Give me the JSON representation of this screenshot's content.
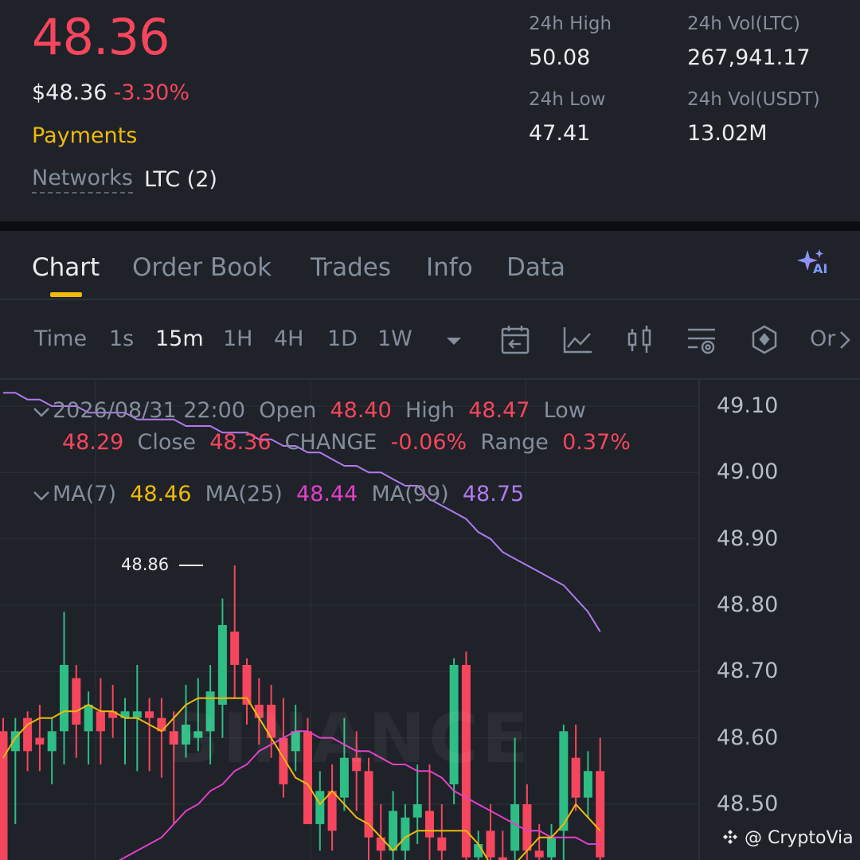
{
  "ticker": {
    "last_price": "48.36",
    "usd_price": "$48.36",
    "change_pct": "-3.30%",
    "category": "Payments",
    "networks_label": "Networks",
    "networks_value": "LTC (2)"
  },
  "stats": {
    "high_label": "24h High",
    "high_value": "50.08",
    "low_label": "24h Low",
    "low_value": "47.41",
    "vol_base_label": "24h Vol(LTC)",
    "vol_base_value": "267,941.17",
    "vol_quote_label": "24h Vol(USDT)",
    "vol_quote_value": "13.02M"
  },
  "tabs": [
    "Chart",
    "Order Book",
    "Trades",
    "Info",
    "Data"
  ],
  "ai_label": "AI",
  "timeframes": {
    "label": "Time",
    "items": [
      "1s",
      "15m",
      "1H",
      "4H",
      "1D",
      "1W"
    ],
    "more": "Or"
  },
  "candle_info": {
    "datetime": "2026/08/31 22:00",
    "open_label": "Open",
    "open": "48.40",
    "high_label": "High",
    "high": "48.47",
    "low_label": "Low",
    "low": "48.29",
    "close_label": "Close",
    "close": "48.36",
    "change_label": "CHANGE",
    "change": "-0.06%",
    "range_label": "Range",
    "range": "0.37%"
  },
  "ma_info": {
    "ma7_label": "MA(7)",
    "ma7": "48.46",
    "ma25_label": "MA(25)",
    "ma25": "48.44",
    "ma99_label": "MA(99)",
    "ma99": "48.75"
  },
  "price_axis": [
    "49.10",
    "49.00",
    "48.90",
    "48.80",
    "48.70",
    "48.60",
    "48.50"
  ],
  "max_marker": "48.86",
  "watermark": "BINANCE",
  "credit": "@ CryptoVia",
  "colors": {
    "up": "#2ebd85",
    "down": "#f6465d",
    "ma7": "#f0b90b",
    "ma25": "#e040c8",
    "ma99": "#b179f1",
    "accent": "#f0b90b"
  },
  "chart_data": {
    "type": "candlestick",
    "interval": "15m",
    "ylim": [
      48.4,
      49.13
    ],
    "candles": [
      {
        "o": 48.61,
        "h": 48.63,
        "l": 48.38,
        "c": 48.41
      },
      {
        "o": 48.58,
        "h": 48.63,
        "l": 48.47,
        "c": 48.61
      },
      {
        "o": 48.63,
        "h": 48.64,
        "l": 48.55,
        "c": 48.58
      },
      {
        "o": 48.6,
        "h": 48.65,
        "l": 48.55,
        "c": 48.59
      },
      {
        "o": 48.58,
        "h": 48.63,
        "l": 48.53,
        "c": 48.61
      },
      {
        "o": 48.61,
        "h": 48.79,
        "l": 48.56,
        "c": 48.71
      },
      {
        "o": 48.69,
        "h": 48.71,
        "l": 48.57,
        "c": 48.62
      },
      {
        "o": 48.61,
        "h": 48.67,
        "l": 48.56,
        "c": 48.65
      },
      {
        "o": 48.64,
        "h": 48.69,
        "l": 48.56,
        "c": 48.61
      },
      {
        "o": 48.64,
        "h": 48.68,
        "l": 48.6,
        "c": 48.63
      },
      {
        "o": 48.63,
        "h": 48.66,
        "l": 48.56,
        "c": 48.64
      },
      {
        "o": 48.63,
        "h": 48.71,
        "l": 48.55,
        "c": 48.64
      },
      {
        "o": 48.64,
        "h": 48.66,
        "l": 48.55,
        "c": 48.63
      },
      {
        "o": 48.63,
        "h": 48.66,
        "l": 48.54,
        "c": 48.61
      },
      {
        "o": 48.61,
        "h": 48.64,
        "l": 48.47,
        "c": 48.59
      },
      {
        "o": 48.59,
        "h": 48.68,
        "l": 48.57,
        "c": 48.62
      },
      {
        "o": 48.6,
        "h": 48.69,
        "l": 48.58,
        "c": 48.61
      },
      {
        "o": 48.61,
        "h": 48.71,
        "l": 48.56,
        "c": 48.67
      },
      {
        "o": 48.65,
        "h": 48.81,
        "l": 48.6,
        "c": 48.77
      },
      {
        "o": 48.76,
        "h": 48.86,
        "l": 48.66,
        "c": 48.71
      },
      {
        "o": 48.71,
        "h": 48.72,
        "l": 48.62,
        "c": 48.65
      },
      {
        "o": 48.65,
        "h": 48.69,
        "l": 48.59,
        "c": 48.63
      },
      {
        "o": 48.65,
        "h": 48.68,
        "l": 48.57,
        "c": 48.6
      },
      {
        "o": 48.6,
        "h": 48.66,
        "l": 48.51,
        "c": 48.53
      },
      {
        "o": 48.58,
        "h": 48.65,
        "l": 48.55,
        "c": 48.61
      },
      {
        "o": 48.61,
        "h": 48.63,
        "l": 48.5,
        "c": 48.47
      },
      {
        "o": 48.47,
        "h": 48.55,
        "l": 48.43,
        "c": 48.52
      },
      {
        "o": 48.52,
        "h": 48.56,
        "l": 48.43,
        "c": 48.46
      },
      {
        "o": 48.51,
        "h": 48.63,
        "l": 48.49,
        "c": 48.57
      },
      {
        "o": 48.57,
        "h": 48.61,
        "l": 48.49,
        "c": 48.55
      },
      {
        "o": 48.55,
        "h": 48.57,
        "l": 48.4,
        "c": 48.45
      },
      {
        "o": 48.45,
        "h": 48.5,
        "l": 48.4,
        "c": 48.43
      },
      {
        "o": 48.43,
        "h": 48.52,
        "l": 48.4,
        "c": 48.49
      },
      {
        "o": 48.43,
        "h": 48.5,
        "l": 48.4,
        "c": 48.48
      },
      {
        "o": 48.48,
        "h": 48.56,
        "l": 48.44,
        "c": 48.5
      },
      {
        "o": 48.49,
        "h": 48.56,
        "l": 48.41,
        "c": 48.45
      },
      {
        "o": 48.45,
        "h": 48.5,
        "l": 48.4,
        "c": 48.43
      },
      {
        "o": 48.53,
        "h": 48.72,
        "l": 48.5,
        "c": 48.71
      },
      {
        "o": 48.71,
        "h": 48.73,
        "l": 48.4,
        "c": 48.42
      },
      {
        "o": 48.42,
        "h": 48.46,
        "l": 48.4,
        "c": 48.44
      },
      {
        "o": 48.46,
        "h": 48.5,
        "l": 48.4,
        "c": 48.42
      },
      {
        "o": 48.42,
        "h": 48.46,
        "l": 48.4,
        "c": 48.41
      },
      {
        "o": 48.43,
        "h": 48.6,
        "l": 48.4,
        "c": 48.5
      },
      {
        "o": 48.5,
        "h": 48.53,
        "l": 48.4,
        "c": 48.43
      },
      {
        "o": 48.43,
        "h": 48.47,
        "l": 48.4,
        "c": 48.42
      },
      {
        "o": 48.42,
        "h": 48.47,
        "l": 48.4,
        "c": 48.45
      },
      {
        "o": 48.46,
        "h": 48.62,
        "l": 48.4,
        "c": 48.61
      },
      {
        "o": 48.57,
        "h": 48.62,
        "l": 48.49,
        "c": 48.51
      },
      {
        "o": 48.51,
        "h": 48.58,
        "l": 48.48,
        "c": 48.55
      },
      {
        "o": 48.55,
        "h": 48.6,
        "l": 48.41,
        "c": 48.42
      }
    ],
    "ma7": [
      48.57,
      48.6,
      48.62,
      48.63,
      48.63,
      48.64,
      48.64,
      48.65,
      48.64,
      48.64,
      48.63,
      48.63,
      48.62,
      48.61,
      48.63,
      48.65,
      48.66,
      48.66,
      48.66,
      48.66,
      48.66,
      48.63,
      48.6,
      48.57,
      48.54,
      48.53,
      48.5,
      48.52,
      48.5,
      48.48,
      48.47,
      48.45,
      48.43,
      48.45,
      48.46,
      48.46,
      48.46,
      48.46,
      48.46,
      48.44,
      48.41,
      48.4,
      48.41,
      48.43,
      48.45,
      48.45,
      48.47,
      48.5,
      48.48,
      48.46
    ],
    "ma25": [
      48.4,
      48.4,
      48.4,
      48.4,
      48.4,
      48.4,
      48.4,
      48.4,
      48.4,
      48.41,
      48.42,
      48.43,
      48.44,
      48.45,
      48.47,
      48.49,
      48.5,
      48.52,
      48.53,
      48.55,
      48.56,
      48.58,
      48.59,
      48.6,
      48.61,
      48.61,
      48.6,
      48.6,
      48.59,
      48.58,
      48.58,
      48.57,
      48.56,
      48.56,
      48.55,
      48.55,
      48.54,
      48.52,
      48.51,
      48.5,
      48.49,
      48.48,
      48.47,
      48.46,
      48.46,
      48.45,
      48.45,
      48.45,
      48.44,
      48.44
    ],
    "ma99": [
      49.12,
      49.12,
      49.11,
      49.11,
      49.1,
      49.1,
      49.1,
      49.09,
      49.09,
      49.09,
      49.09,
      49.08,
      49.08,
      49.08,
      49.08,
      49.07,
      49.07,
      49.07,
      49.06,
      49.06,
      49.06,
      49.05,
      49.05,
      49.04,
      49.04,
      49.03,
      49.03,
      49.02,
      49.01,
      49.01,
      49.0,
      49.0,
      48.99,
      48.98,
      48.98,
      48.96,
      48.95,
      48.94,
      48.93,
      48.91,
      48.9,
      48.88,
      48.87,
      48.86,
      48.85,
      48.84,
      48.83,
      48.81,
      48.79,
      48.76
    ]
  }
}
